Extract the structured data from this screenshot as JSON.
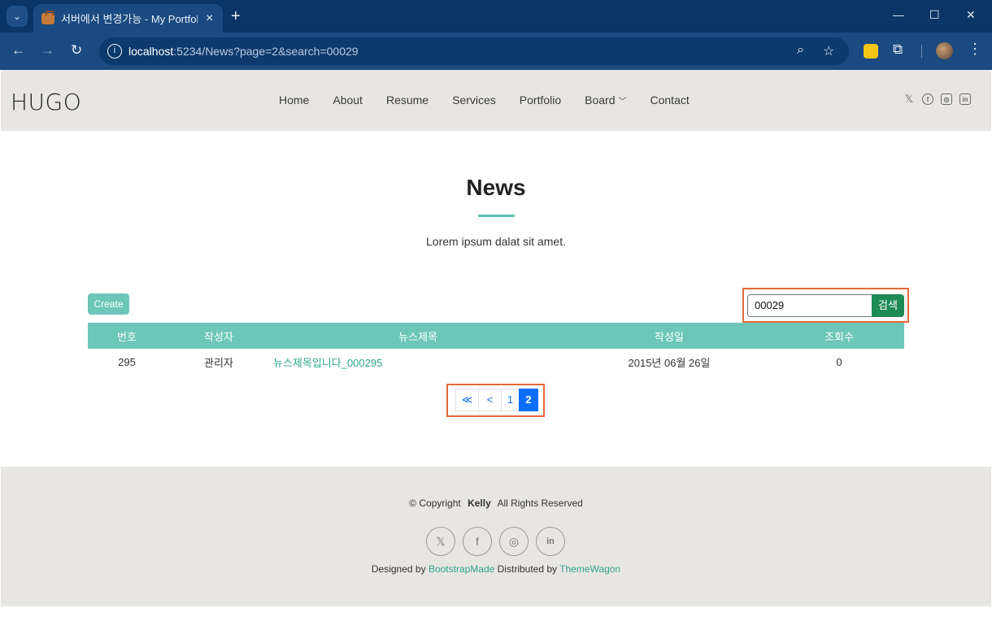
{
  "browser": {
    "tab_title": "서버에서 변경가능 - My Portfolio",
    "url_host": "localhost",
    "url_rest": ":5234/News?page=2&search=00029"
  },
  "site": {
    "logo": "HUGO",
    "nav": [
      {
        "label": "Home"
      },
      {
        "label": "About"
      },
      {
        "label": "Resume"
      },
      {
        "label": "Services"
      },
      {
        "label": "Portfolio"
      },
      {
        "label": "Board"
      },
      {
        "label": "Contact"
      }
    ],
    "social_icons": [
      "x-icon",
      "facebook-icon",
      "instagram-icon",
      "linkedin-icon"
    ]
  },
  "main": {
    "title": "News",
    "subtitle": "Lorem ipsum dalat sit amet.",
    "create_label": "Create",
    "search_value": "00029",
    "search_button": "검색",
    "columns": [
      "번호",
      "작성자",
      "뉴스제목",
      "작성일",
      "조회수"
    ],
    "rows": [
      {
        "no": "295",
        "author": "관리자",
        "title": "뉴스제목입니다_000295",
        "date": "2015년 06월 26일",
        "views": "0"
      }
    ],
    "pagination": {
      "first": "≪",
      "prev": "<",
      "pages": [
        "1",
        "2"
      ],
      "current": "2"
    }
  },
  "footer": {
    "copyright_prefix": "© Copyright",
    "copyright_name": "Kelly",
    "copyright_suffix": "All Rights Reserved",
    "designed_prefix": "Designed by",
    "designed_link": "BootstrapMade",
    "distributed_prefix": "Distributed by",
    "distributed_link": "ThemeWagon"
  },
  "colors": {
    "accent": "#6cc7b8",
    "link": "#2fa48c",
    "search_button": "#1e8a55",
    "page_active": "#0d6efd",
    "highlight_box": "#e16a3a"
  }
}
